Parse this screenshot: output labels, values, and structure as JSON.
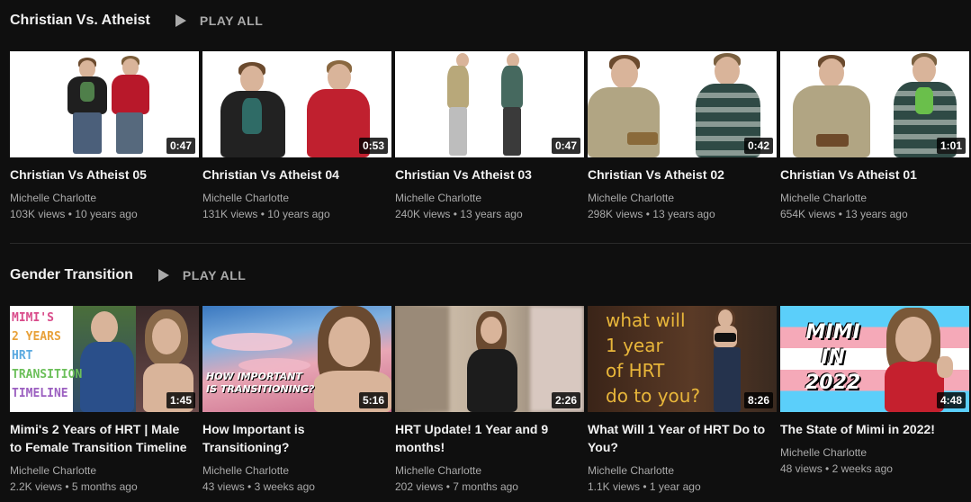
{
  "shelves": [
    {
      "title": "Christian Vs. Atheist",
      "play_all": "PLAY ALL",
      "videos": [
        {
          "title": "Christian Vs Atheist 05",
          "channel": "Michelle Charlotte",
          "views": "103K views",
          "age": "10 years ago",
          "duration": "0:47"
        },
        {
          "title": "Christian Vs Atheist 04",
          "channel": "Michelle Charlotte",
          "views": "131K views",
          "age": "10 years ago",
          "duration": "0:53"
        },
        {
          "title": "Christian Vs Atheist 03",
          "channel": "Michelle Charlotte",
          "views": "240K views",
          "age": "13 years ago",
          "duration": "0:47"
        },
        {
          "title": "Christian Vs Atheist 02",
          "channel": "Michelle Charlotte",
          "views": "298K views",
          "age": "13 years ago",
          "duration": "0:42"
        },
        {
          "title": "Christian Vs Atheist 01",
          "channel": "Michelle Charlotte",
          "views": "654K views",
          "age": "13 years ago",
          "duration": "1:01"
        }
      ]
    },
    {
      "title": "Gender Transition",
      "play_all": "PLAY ALL",
      "videos": [
        {
          "title": "Mimi's 2 Years of HRT | Male to Female Transition Timeline",
          "channel": "Michelle Charlotte",
          "views": "2.2K views",
          "age": "5 months ago",
          "duration": "1:45",
          "thumb_text": [
            "MIMI'S",
            "2 YEARS",
            "HRT",
            "TRANSITION",
            "TIMELINE"
          ]
        },
        {
          "title": "How Important is Transitioning?",
          "channel": "Michelle Charlotte",
          "views": "43 views",
          "age": "3 weeks ago",
          "duration": "5:16",
          "thumb_text": [
            "HOW IMPORTANT",
            "IS TRANSITIONING?"
          ]
        },
        {
          "title": "HRT Update! 1 Year and 9 months!",
          "channel": "Michelle Charlotte",
          "views": "202 views",
          "age": "7 months ago",
          "duration": "2:26"
        },
        {
          "title": "What Will 1 Year of HRT Do to You?",
          "channel": "Michelle Charlotte",
          "views": "1.1K views",
          "age": "1 year ago",
          "duration": "8:26",
          "thumb_text": [
            "what will",
            "1 year",
            "of HRT",
            "do to you?"
          ]
        },
        {
          "title": "The State of Mimi in 2022!",
          "channel": "Michelle Charlotte",
          "views": "48 views",
          "age": "2 weeks ago",
          "duration": "4:48",
          "thumb_text": [
            "MIMI",
            "IN",
            "2022"
          ]
        }
      ]
    }
  ],
  "separator": "•",
  "colors": {
    "background": "#0f0f0f",
    "text_primary": "#f1f1f1",
    "text_secondary": "#aaaaaa"
  }
}
